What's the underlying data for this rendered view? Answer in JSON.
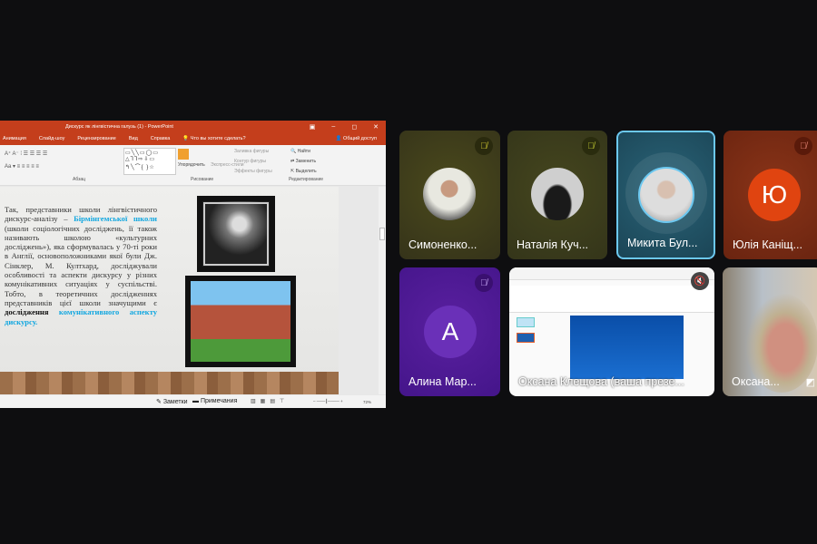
{
  "ppt": {
    "title": "Дискурс як лінгвістична галузь (1) - PowerPoint",
    "tabs": [
      "Анимация",
      "Слайд-шоу",
      "Рецензирование",
      "Вид",
      "Справка",
      "Что вы хотите сделать?"
    ],
    "share": "Общий доступ",
    "ribbon": {
      "paragraph": "Абзац",
      "drawing": "Рисование",
      "editing": "Редактирование",
      "arrange": "Упорядочить",
      "quick_styles": "Экспресс-стили",
      "fill": "Заливка фигуры",
      "outline": "Контур фигуры",
      "effects": "Эффекты фигуры",
      "find": "Найти",
      "replace": "Заменить",
      "select": "Выделить"
    },
    "slide": {
      "p1": "Так, представники школи лінгвістичного дискурс-аналізу – ",
      "blue1": "Бірмінгемської школи",
      "p2": " (школи соціологічних досліджень, її також називають школою «культурних досліджень»), яка сформувалась у 70-ті роки в Англії, основоположниками якої були Дж. Сінклер, М. Култхард, досліджували особливості та аспекти дискурсу у різних комунікативних ситуаціях у суспільстві. Тобто, в теоретичних дослідженнях представників цієї школи значущими є ",
      "bold": "дослідження",
      "blue2": " комунікативного аспекту дискурсу."
    },
    "status": {
      "notes": "Заметки",
      "comments": "Примечания",
      "zoom": "72%"
    }
  },
  "participants": [
    {
      "name": "Симоненко...",
      "bg": "#3c3a14",
      "muted": true
    },
    {
      "name": "Наталія Куч...",
      "bg": "#38391a",
      "muted": true
    },
    {
      "name": "Микита Бул...",
      "bg": "#1c4a5c",
      "muted": false,
      "speaking": true
    },
    {
      "name": "Юлія Каніщ...",
      "bg": "#7a2a14",
      "muted": true,
      "initial": "Ю"
    },
    {
      "name": "Алина Мар...",
      "bg": "#4a1a8a",
      "muted": true,
      "initial": "А"
    },
    {
      "name": "Оксана Клещова (ваша презе...",
      "bg": "#ffffff",
      "muted": true,
      "screen": true
    },
    {
      "name": "Оксана...",
      "bg": "#6f7e88",
      "muted": false
    }
  ]
}
